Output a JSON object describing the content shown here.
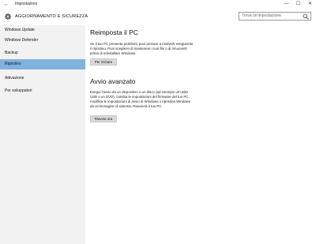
{
  "window": {
    "back_icon": "back-arrow-icon",
    "title": "Impostazioni",
    "controls": {
      "minimize": "—",
      "maximize": "☐",
      "close": "✕"
    }
  },
  "header": {
    "icon": "gear-icon",
    "title": "AGGIORNAMENTO E SICUREZZA",
    "search_placeholder": "Trova un'impostazione",
    "search_icon": "search-icon"
  },
  "sidebar": {
    "items": [
      {
        "label": "Windows Update",
        "active": false
      },
      {
        "label": "Windows Defender",
        "active": false
      },
      {
        "label": "Backup",
        "active": false
      },
      {
        "label": "Ripristino",
        "active": true
      },
      {
        "label": "Attivazione",
        "active": false
      },
      {
        "label": "Per sviluppatori",
        "active": false
      }
    ]
  },
  "main": {
    "reset": {
      "title": "Reimposta il PC",
      "lines": [
        "Se il tuo PC presenta problemi, puoi provare a risolverli eseguendo",
        "il ripristino. Puoi scegliere di mantenere i tuoi file o di rimuoverli",
        "prima di reinstallare Windows."
      ],
      "button": "Per iniziare"
    },
    "advanced": {
      "title": "Avvio avanzato",
      "lines": [
        "Esegui l'avvio da un dispositivo o un disco (ad esempio un'unità",
        "USB o un DVD), cambia le impostazioni del firmware del tuo PC,",
        "modifica le impostazioni di avvio di Windows o ripristina Windows",
        "da un'immagine di sistema. Riavvierà il tuo PC."
      ],
      "button": "Riavvia ora"
    }
  },
  "colors": {
    "sidebar_bg": "#f2f2f2",
    "active_item": "#7fb2de",
    "button_bg": "#d9d9d9"
  }
}
